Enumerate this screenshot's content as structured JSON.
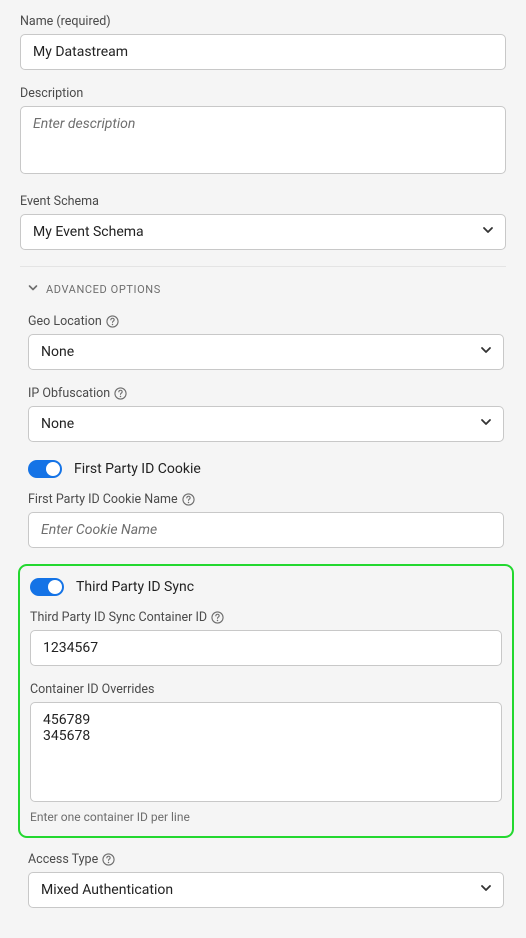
{
  "name": {
    "label": "Name (required)",
    "value": "My Datastream"
  },
  "description": {
    "label": "Description",
    "placeholder": "Enter description"
  },
  "eventSchema": {
    "label": "Event Schema",
    "value": "My Event Schema"
  },
  "advanced": {
    "header": "ADVANCED OPTIONS",
    "geoLocation": {
      "label": "Geo Location",
      "value": "None"
    },
    "ipObfuscation": {
      "label": "IP Obfuscation",
      "value": "None"
    },
    "firstPartyCookie": {
      "toggle": "First Party ID Cookie",
      "nameLabel": "First Party ID Cookie Name",
      "placeholder": "Enter Cookie Name"
    },
    "thirdPartySync": {
      "toggle": "Third Party ID Sync",
      "containerIdLabel": "Third Party ID Sync Container ID",
      "containerId": "1234567",
      "overridesLabel": "Container ID Overrides",
      "overrides": "456789\n345678",
      "help": "Enter one container ID per line"
    },
    "accessType": {
      "label": "Access Type",
      "value": "Mixed Authentication"
    }
  }
}
